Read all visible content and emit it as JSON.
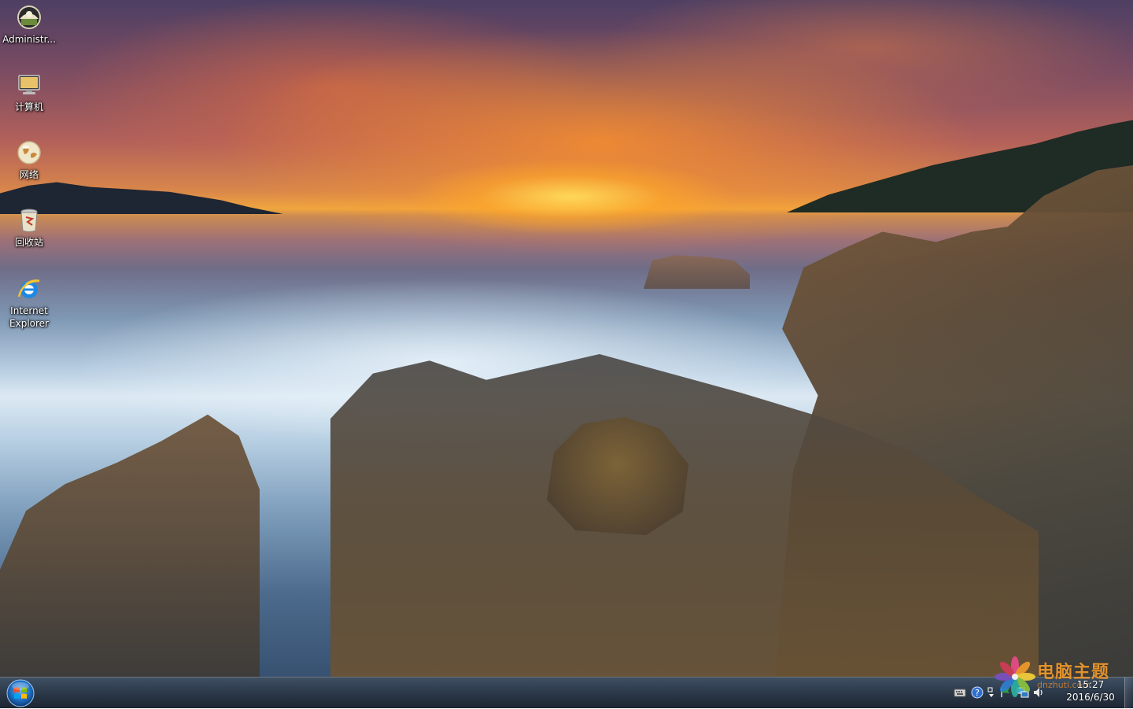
{
  "desktop": {
    "icons": [
      {
        "label": "Administr..."
      },
      {
        "label": "计算机"
      },
      {
        "label": "网络"
      },
      {
        "label": "回收站"
      },
      {
        "label": "Internet\nExplorer"
      }
    ]
  },
  "taskbar": {
    "clock": {
      "time": "15:27",
      "date": "2016/6/30"
    }
  },
  "watermark": {
    "text": "电脑主题",
    "url": "dnzhuti.com"
  },
  "colors": {
    "taskbar": "#28303a",
    "start_orb_blue": "#1f6fc4",
    "watermark_orange": "#f39c2c"
  }
}
